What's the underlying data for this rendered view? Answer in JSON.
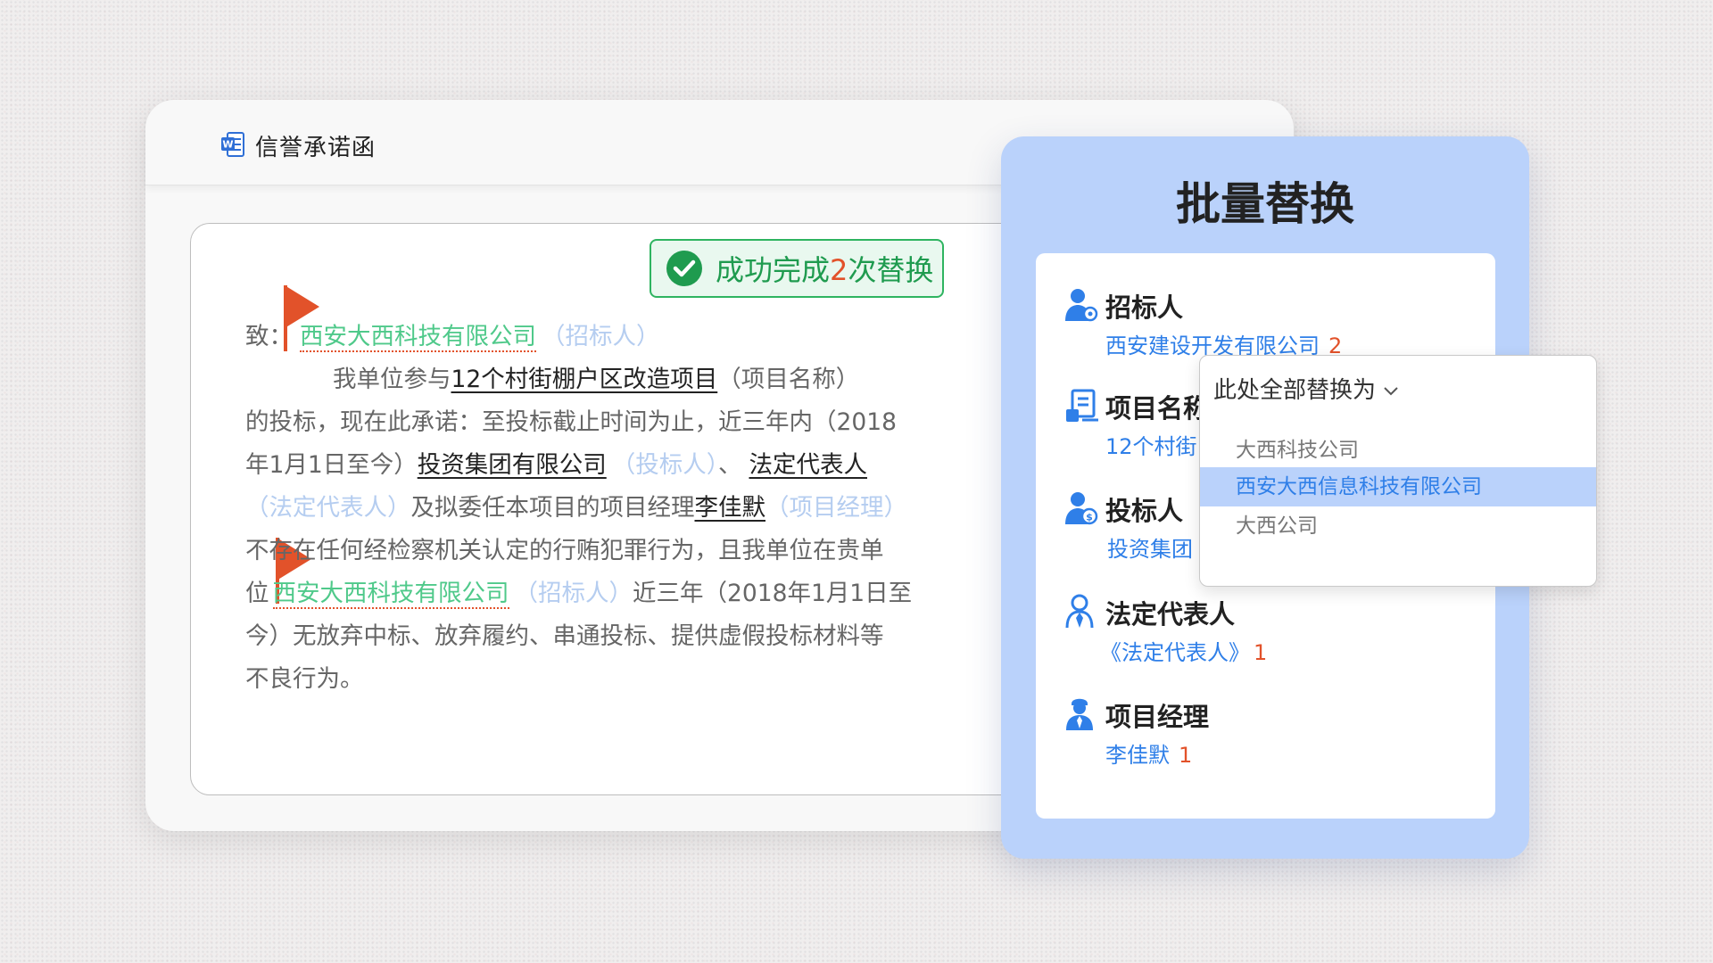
{
  "document": {
    "title": "信誉承诺函",
    "toast": {
      "prefix": "成功完成",
      "count": "2",
      "suffix": "次替换"
    },
    "lines": [
      {
        "l1a": "致：",
        "l1b": "西安大西科技有限公司",
        "l1c": "（招标人）"
      },
      {
        "a": "我单位参与",
        "b": "12个村街棚户区改造项目",
        "c": "（项目名称）"
      },
      {
        "a": "的投标，现在此承诺：至投标截止时间为止，近三年内（2018"
      },
      {
        "a": "年1月1日至今）",
        "b": "投资集团有限公司",
        "c": "（投标人）",
        "d": "、",
        "e": "法定代表人"
      },
      {
        "a": "（法定代表人）",
        "b": "及拟委任本项目的项目经理",
        "c": "李佳默",
        "d": "（项目经理）"
      },
      {
        "a": "不存在任何经检察机关认定的行贿犯罪行为，且我单位在贵单"
      },
      {
        "a": "位",
        "b": "西安大西科技有限公司",
        "c": "（招标人）",
        "d": "近三年（2018年1月1日至"
      },
      {
        "a": "今）无放弃中标、放弃履约、串通投标、提供虚假投标材料等"
      },
      {
        "a": "不良行为。"
      }
    ]
  },
  "panel": {
    "title": "批量替换",
    "fields": [
      {
        "label": "招标人",
        "value": "西安建设开发有限公司",
        "count": "2",
        "icon": "bidder-user-icon"
      },
      {
        "label": "项目名称",
        "value": "12个村街",
        "count": "",
        "icon": "project-document-icon"
      },
      {
        "label": "投标人",
        "value": "投资集团",
        "count": "",
        "icon": "tenderer-user-icon"
      },
      {
        "label": "法定代表人",
        "value": "《法定代表人》",
        "count": "1",
        "icon": "legal-representative-icon"
      },
      {
        "label": "项目经理",
        "value": "李佳默",
        "count": "1",
        "icon": "project-manager-icon"
      }
    ]
  },
  "dropdown": {
    "header": "此处全部替换为",
    "options": [
      "大西科技公司",
      "西安大西信息科技有限公司",
      "大西公司"
    ],
    "selected": "西安大西信息科技有限公司"
  },
  "colors": {
    "accent_blue": "#2f7fe8",
    "panel_bg": "#bad2fb",
    "success_green": "#2eb460",
    "count_red": "#e2522a",
    "replaced_text_green": "#4fc98a",
    "placeholder_blue": "#b5cdf0"
  }
}
